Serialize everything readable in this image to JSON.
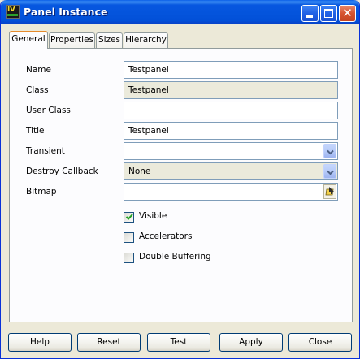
{
  "window": {
    "title": "Panel Instance",
    "icon": "ilog-views-app-icon",
    "controls": {
      "minimize": "minimize-icon",
      "maximize": "maximize-icon",
      "close": "close-icon"
    }
  },
  "tabs": [
    {
      "label": "General",
      "active": true
    },
    {
      "label": "Properties",
      "active": false
    },
    {
      "label": "Sizes",
      "active": false
    },
    {
      "label": "Hierarchy",
      "active": false
    }
  ],
  "form": {
    "name": {
      "label": "Name",
      "value": "Testpanel"
    },
    "class": {
      "label": "Class",
      "value": "Testpanel"
    },
    "user_class": {
      "label": "User Class",
      "value": ""
    },
    "title": {
      "label": "Title",
      "value": "Testpanel"
    },
    "transient": {
      "label": "Transient",
      "value": ""
    },
    "destroy_callback": {
      "label": "Destroy Callback",
      "value": "None"
    },
    "bitmap": {
      "label": "Bitmap",
      "value": "",
      "browse_icon": "folder-browse-icon"
    }
  },
  "options": [
    {
      "label": "Visible",
      "checked": true
    },
    {
      "label": "Accelerators",
      "checked": false
    },
    {
      "label": "Double Buffering",
      "checked": false
    }
  ],
  "buttons": {
    "help": "Help",
    "reset": "Reset",
    "test": "Test",
    "apply": "Apply",
    "close": "Close"
  },
  "colors": {
    "titlebar": "#0454dc",
    "active_tab_accent": "#e68b2c",
    "readonly_field": "#ebeadb",
    "check_mark": "#21a121"
  }
}
